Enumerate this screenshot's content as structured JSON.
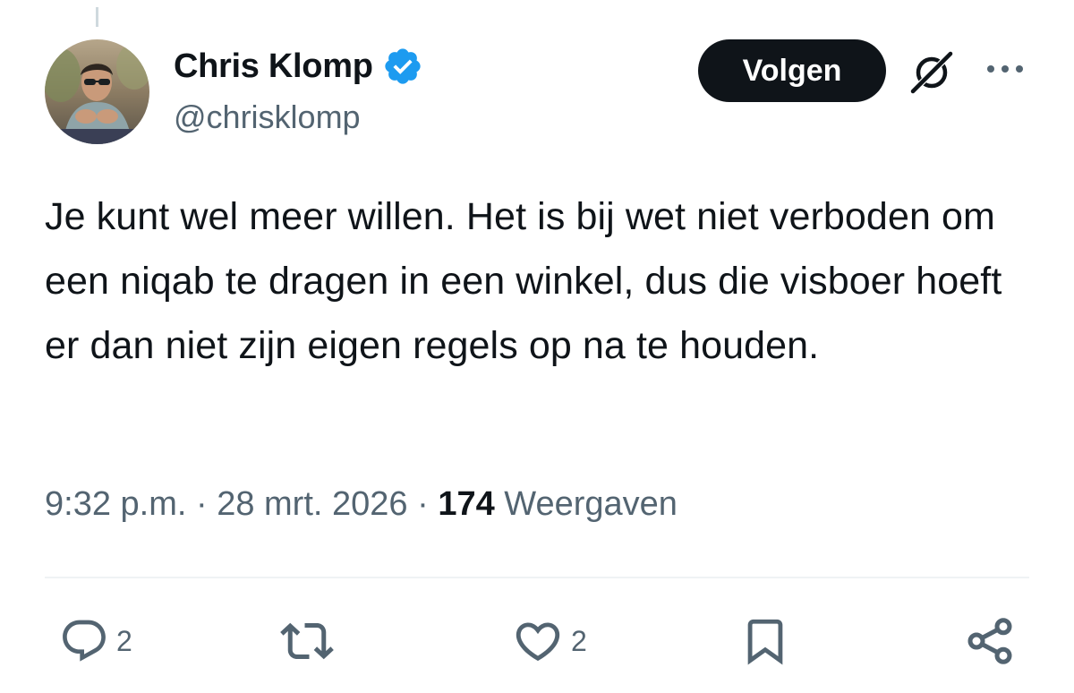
{
  "author": {
    "display_name": "Chris Klomp",
    "handle": "@chrisklomp",
    "verified": true
  },
  "follow_button": {
    "label": "Volgen"
  },
  "header_icons": {
    "grok": "grok-icon",
    "more": "more-icon"
  },
  "tweet": {
    "text": "Je kunt wel meer willen. Het is bij wet niet verboden om een niqab te dragen in een winkel, dus die visboer hoeft er dan niet zijn eigen regels op na te houden.",
    "time": "9:32 p.m.",
    "date": "28 mrt. 2026",
    "separator": "·",
    "views_count": "174",
    "views_label": "Weergaven"
  },
  "actions": {
    "reply": {
      "icon": "reply-icon",
      "count": "2"
    },
    "repost": {
      "icon": "repost-icon",
      "count": ""
    },
    "like": {
      "icon": "heart-icon",
      "count": "2"
    },
    "bookmark": {
      "icon": "bookmark-icon"
    },
    "share": {
      "icon": "share-icon"
    }
  },
  "colors": {
    "text_primary": "#0f1419",
    "text_secondary": "#536471",
    "verified_blue": "#1d9bf0",
    "button_bg": "#0f1419",
    "divider": "#eff3f4"
  }
}
